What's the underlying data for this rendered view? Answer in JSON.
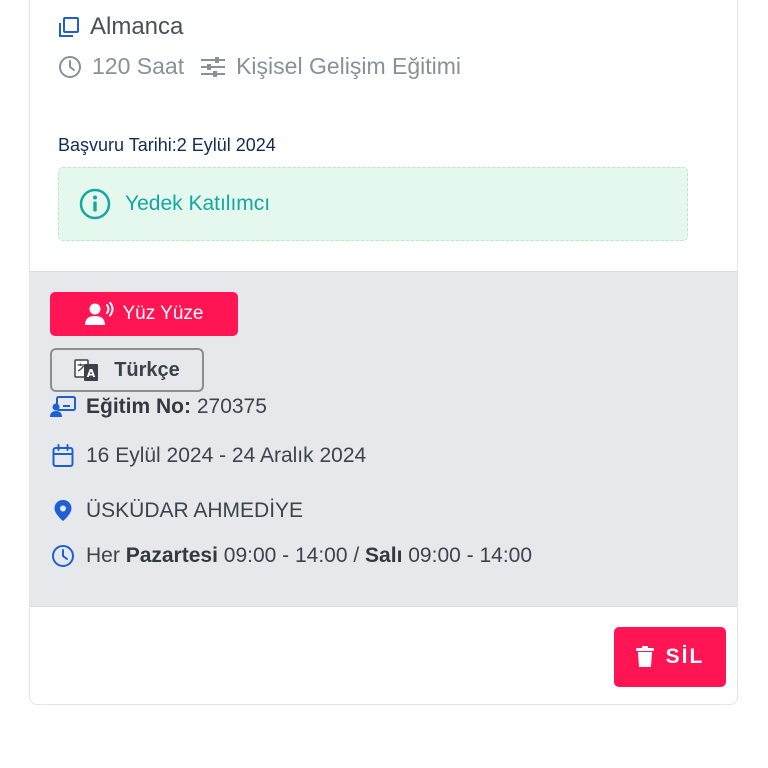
{
  "course": {
    "name": "Almanca",
    "duration": "120 Saat",
    "category": "Kişisel Gelişim Eğitimi",
    "apply_label": "Başvuru Tarihi:",
    "apply_date": "2 Eylül 2024",
    "status": "Yedek Katılımcı"
  },
  "details": {
    "mode_badge": "Yüz Yüze",
    "language_badge": "Türkçe",
    "training_no_label": "Eğitim No:",
    "training_no": "270375",
    "date_range": "16 Eylül 2024 - 24 Aralık 2024",
    "location": "ÜSKÜDAR AHMEDİYE",
    "schedule_prefix": "Her",
    "schedule_day1": "Pazartesi",
    "schedule_time1": "09:00 - 14:00 /",
    "schedule_day2": "Salı",
    "schedule_time2": "09:00 - 14:00"
  },
  "actions": {
    "delete_label": "SİL"
  },
  "icons": {
    "course": "copy-icon",
    "duration": "clock-icon",
    "category": "sliders-icon",
    "status": "info-circle-icon",
    "mode": "person-voice-icon",
    "language": "translate-icon",
    "training_no": "chalkboard-user-icon",
    "dates": "calendar-icon",
    "location": "map-pin-icon",
    "schedule": "clock-icon",
    "delete": "trash-icon"
  },
  "colors": {
    "primary_red": "#ff1554",
    "accent_blue": "#1f5fd6",
    "teal": "#13a8a0",
    "alert_bg": "#e4f8ee",
    "gray_bg": "#e6e8eb"
  }
}
